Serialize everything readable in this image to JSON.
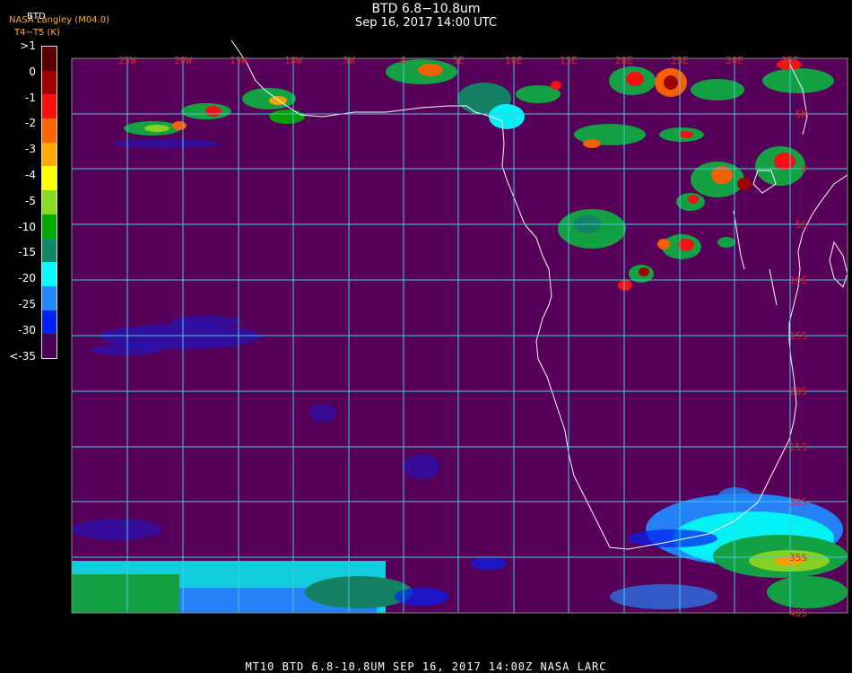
{
  "title": "BTD 6.8−10.8um",
  "subtitle": "Sep 16, 2017 14:00 UTC",
  "org_line1": "NASA Langley (M04.0)",
  "org_line2": "T4−T5 (K)",
  "legend_top": "BTD",
  "legend": {
    "labels": [
      ">1",
      "0",
      "-1",
      "-2",
      "-3",
      "-4",
      "-5",
      "-10",
      "-15",
      "-20",
      "-25",
      "-30",
      "<-35"
    ],
    "colors": [
      "#5a0000",
      "#a00000",
      "#ff1010",
      "#ff6600",
      "#ffaa00",
      "#ffff00",
      "#88dd22",
      "#00aa00",
      "#118866",
      "#00ffff",
      "#2288ff",
      "#0022ff",
      "#4a0055"
    ]
  },
  "lon_labels": [
    "25W",
    "20W",
    "15W",
    "10W",
    "5W",
    "0",
    "5E",
    "10E",
    "15E",
    "20E",
    "25E",
    "30E",
    "35E"
  ],
  "lat_labels": [
    "5N",
    "0",
    "5S",
    "10S",
    "15S",
    "20S",
    "25S",
    "30S",
    "35S",
    "40S"
  ],
  "footer": "MT10  BTD 6.8-10.8UM   SEP 16, 2017 14:00Z   NASA LARC",
  "colors": {
    "background": "#56005a",
    "grid": "#44ccdd",
    "coast": "#ffffff",
    "label": "#dd2222"
  }
}
